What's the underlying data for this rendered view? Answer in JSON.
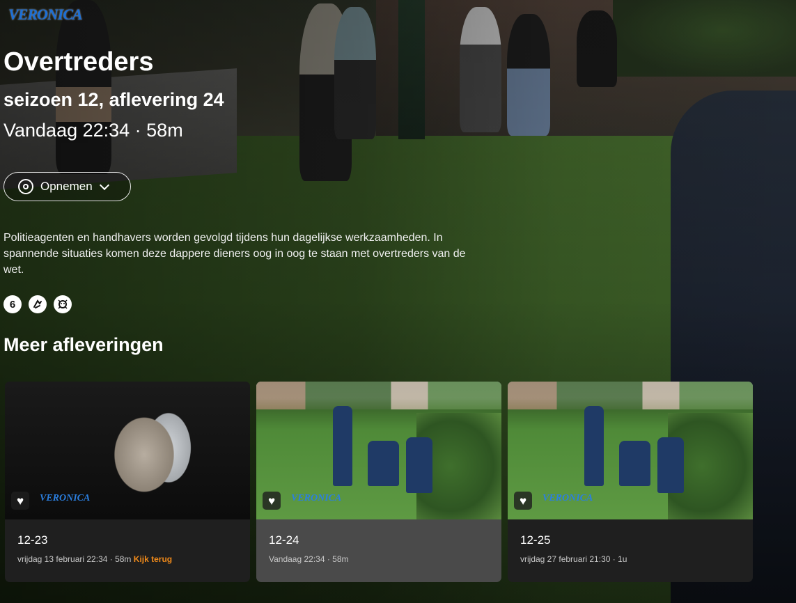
{
  "brand": {
    "logo_text": "VERONICA"
  },
  "show": {
    "title": "Overtreders",
    "subtitle": "seizoen 12, aflevering 24",
    "airtime": "Vandaag 22:34 · 58m",
    "description": "Politieagenten en handhavers worden gevolgd tijdens hun dagelijkse werkzaamheden. In spannende situaties komen deze dappere dieners oog in oog te staan met overtreders van de wet.",
    "ratings": [
      {
        "label": "6",
        "icon": "age-6-icon"
      },
      {
        "label": "",
        "icon": "violence-icon"
      },
      {
        "label": "",
        "icon": "fear-icon"
      }
    ]
  },
  "actions": {
    "record_label": "Opnemen"
  },
  "more": {
    "title": "Meer afleveringen",
    "episodes": [
      {
        "code": "12-23",
        "meta": "vrijdag 13 februari 22:34 · 58m",
        "extra": "Kijk terug",
        "logo": "VERONICA"
      },
      {
        "code": "12-24",
        "meta": "Vandaag 22:34 · 58m",
        "extra": "",
        "logo": "VERONICA"
      },
      {
        "code": "12-25",
        "meta": "vrijdag 27 februari 21:30 · 1u",
        "extra": "",
        "logo": "VERONICA"
      }
    ]
  },
  "colors": {
    "accent_orange": "#f08a1a",
    "brand_blue": "#1c6fd6"
  }
}
